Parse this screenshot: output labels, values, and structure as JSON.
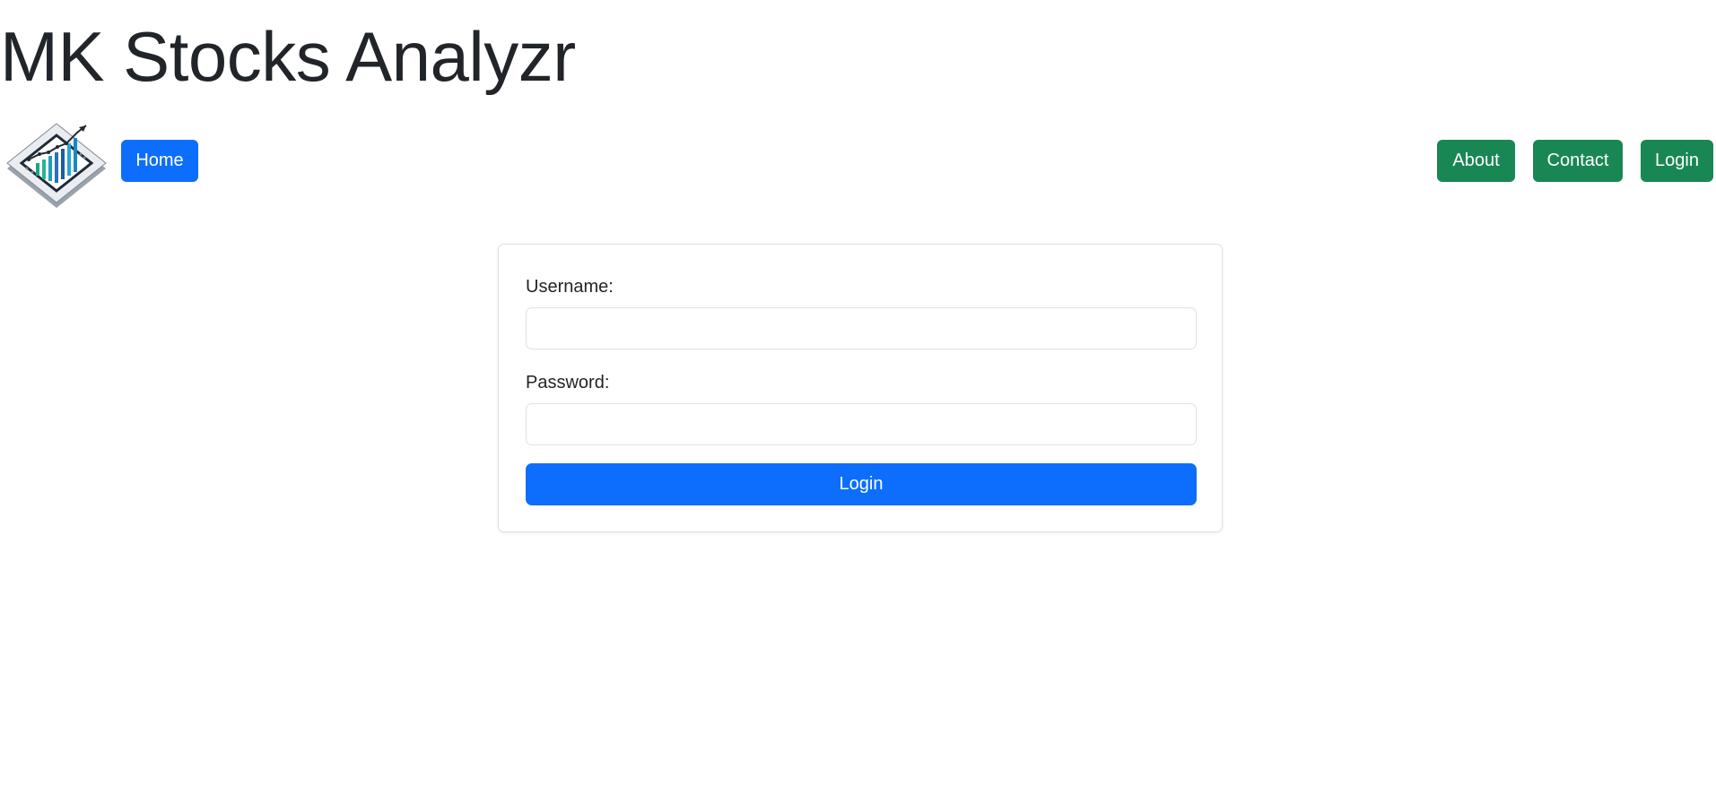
{
  "header": {
    "title": "MK Stocks Analyzr"
  },
  "nav": {
    "logo_icon": "stock-chart-logo-icon",
    "home_label": "Home",
    "about_label": "About",
    "contact_label": "Contact",
    "login_label": "Login"
  },
  "form": {
    "username_label": "Username:",
    "username_value": "",
    "password_label": "Password:",
    "password_value": "",
    "submit_label": "Login"
  },
  "colors": {
    "primary": "#0d6efd",
    "success": "#198754",
    "text": "#212529",
    "border": "#dee2e6"
  }
}
